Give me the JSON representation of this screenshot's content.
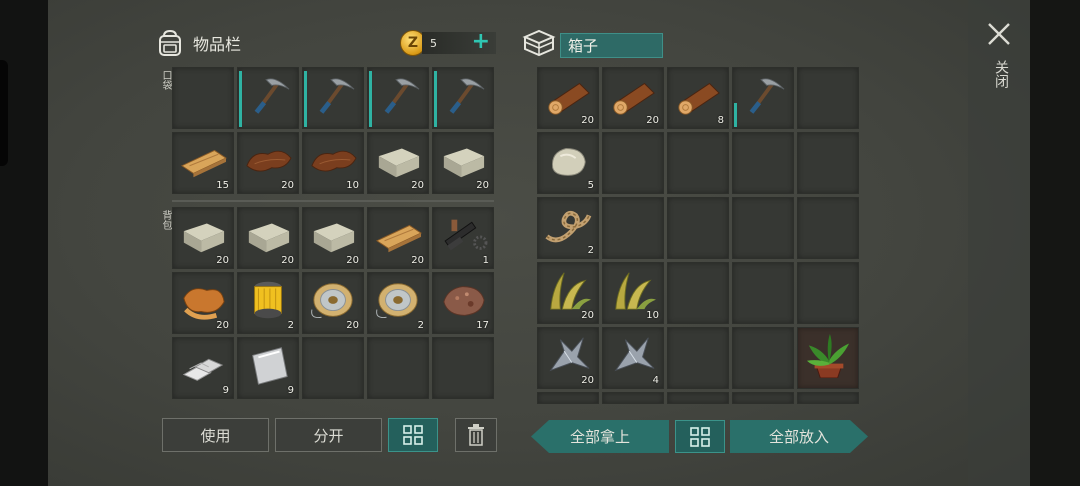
{
  "inventory": {
    "title": "物品栏",
    "coins": "5",
    "pocket_label": "口袋",
    "backpack_label": "背包",
    "pocket_slots": [
      {
        "item": "",
        "icon": "empty-slot"
      },
      {
        "item": "pickaxe",
        "icon": "pickaxe-icon",
        "count": ""
      },
      {
        "item": "pickaxe",
        "icon": "pickaxe-icon",
        "count": ""
      },
      {
        "item": "pickaxe",
        "icon": "pickaxe-icon",
        "count": ""
      },
      {
        "item": "pickaxe",
        "icon": "pickaxe-icon",
        "count": ""
      },
      {
        "item": "plank",
        "icon": "plank-icon",
        "count": "15"
      },
      {
        "item": "leather",
        "icon": "leather-icon",
        "count": "20"
      },
      {
        "item": "leather",
        "icon": "leather-icon",
        "count": "10"
      },
      {
        "item": "stone",
        "icon": "stone-block-icon",
        "count": "20"
      },
      {
        "item": "stone",
        "icon": "stone-block-icon",
        "count": "20"
      }
    ],
    "backpack_slots": [
      {
        "item": "stone",
        "icon": "stone-block-icon",
        "count": "20"
      },
      {
        "item": "stone",
        "icon": "stone-block-icon",
        "count": "20"
      },
      {
        "item": "stone",
        "icon": "stone-block-icon",
        "count": "20"
      },
      {
        "item": "plank",
        "icon": "plank-icon",
        "count": "20"
      },
      {
        "item": "gun-parts",
        "icon": "gun-parts-icon",
        "count": "1"
      },
      {
        "item": "fur",
        "icon": "fur-icon",
        "count": "20"
      },
      {
        "item": "filter",
        "icon": "filter-icon",
        "count": "2"
      },
      {
        "item": "wire-spool",
        "icon": "spool-icon",
        "count": "20"
      },
      {
        "item": "wire-spool",
        "icon": "spool-icon",
        "count": "2"
      },
      {
        "item": "ore",
        "icon": "ore-icon",
        "count": "17"
      },
      {
        "item": "metal-bars",
        "icon": "ingot-icon",
        "count": "9"
      },
      {
        "item": "metal-plate",
        "icon": "metal-plate-icon",
        "count": "9"
      },
      {
        "item": "",
        "icon": "empty-slot"
      },
      {
        "item": "",
        "icon": "empty-slot"
      },
      {
        "item": "",
        "icon": "empty-slot"
      }
    ],
    "buttons": {
      "use": "使用",
      "split": "分开"
    }
  },
  "chest": {
    "title": "箱子",
    "slots": [
      {
        "item": "log",
        "icon": "log-icon",
        "count": "20"
      },
      {
        "item": "log",
        "icon": "log-icon",
        "count": "20"
      },
      {
        "item": "log",
        "icon": "log-icon",
        "count": "8"
      },
      {
        "item": "pickaxe",
        "icon": "pickaxe-icon",
        "count": ""
      },
      {
        "item": "",
        "icon": "empty-slot"
      },
      {
        "item": "rock",
        "icon": "rock-icon",
        "count": "5"
      },
      {
        "item": "",
        "icon": "empty-slot"
      },
      {
        "item": "",
        "icon": "empty-slot"
      },
      {
        "item": "",
        "icon": "empty-slot"
      },
      {
        "item": "",
        "icon": "empty-slot"
      },
      {
        "item": "rope",
        "icon": "rope-icon",
        "count": "2"
      },
      {
        "item": "",
        "icon": "empty-slot"
      },
      {
        "item": "",
        "icon": "empty-slot"
      },
      {
        "item": "",
        "icon": "empty-slot"
      },
      {
        "item": "",
        "icon": "empty-slot"
      },
      {
        "item": "plant-fiber",
        "icon": "plant-fiber-icon",
        "count": "20"
      },
      {
        "item": "plant-fiber",
        "icon": "plant-fiber-icon",
        "count": "10"
      },
      {
        "item": "",
        "icon": "empty-slot"
      },
      {
        "item": "",
        "icon": "empty-slot"
      },
      {
        "item": "",
        "icon": "empty-slot"
      },
      {
        "item": "metal-scrap",
        "icon": "metal-scrap-icon",
        "count": "20"
      },
      {
        "item": "metal-scrap",
        "icon": "metal-scrap-icon",
        "count": "4"
      },
      {
        "item": "",
        "icon": "empty-slot"
      },
      {
        "item": "",
        "icon": "empty-slot"
      },
      {
        "item": "potted-plant",
        "icon": "potted-plant-icon",
        "count": ""
      }
    ],
    "buttons": {
      "take_all": "全部拿上",
      "put_all": "全部放入"
    }
  },
  "close_label": "关闭",
  "colors": {
    "accent": "#2fb3a3",
    "button_teal": "#2a706a",
    "slot": "#363834"
  }
}
